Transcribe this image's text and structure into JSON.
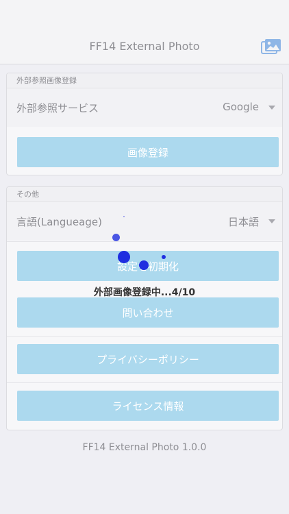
{
  "nav": {
    "title": "FF14 External Photo",
    "photo_icon": "photo-library-icon"
  },
  "section_external": {
    "header": "外部参照画像登録",
    "service_label": "外部参照サービス",
    "service_value": "Google",
    "register_button": "画像登録"
  },
  "section_other": {
    "header": "その他",
    "language_label": "言語(Langueage)",
    "language_value": "日本語",
    "reset_button": "設定を初期化",
    "contact_button": "問い合わせ",
    "privacy_button": "プライバシーポリシー",
    "license_button": "ライセンス情報"
  },
  "progress": {
    "text": "外部画像登録中...4/10",
    "current": 4,
    "total": 10
  },
  "footer": {
    "version": "FF14 External Photo 1.0.0"
  },
  "colors": {
    "accent_button": "#acd9ee",
    "spinner": "#1f2ee0",
    "background": "#efeff4"
  }
}
